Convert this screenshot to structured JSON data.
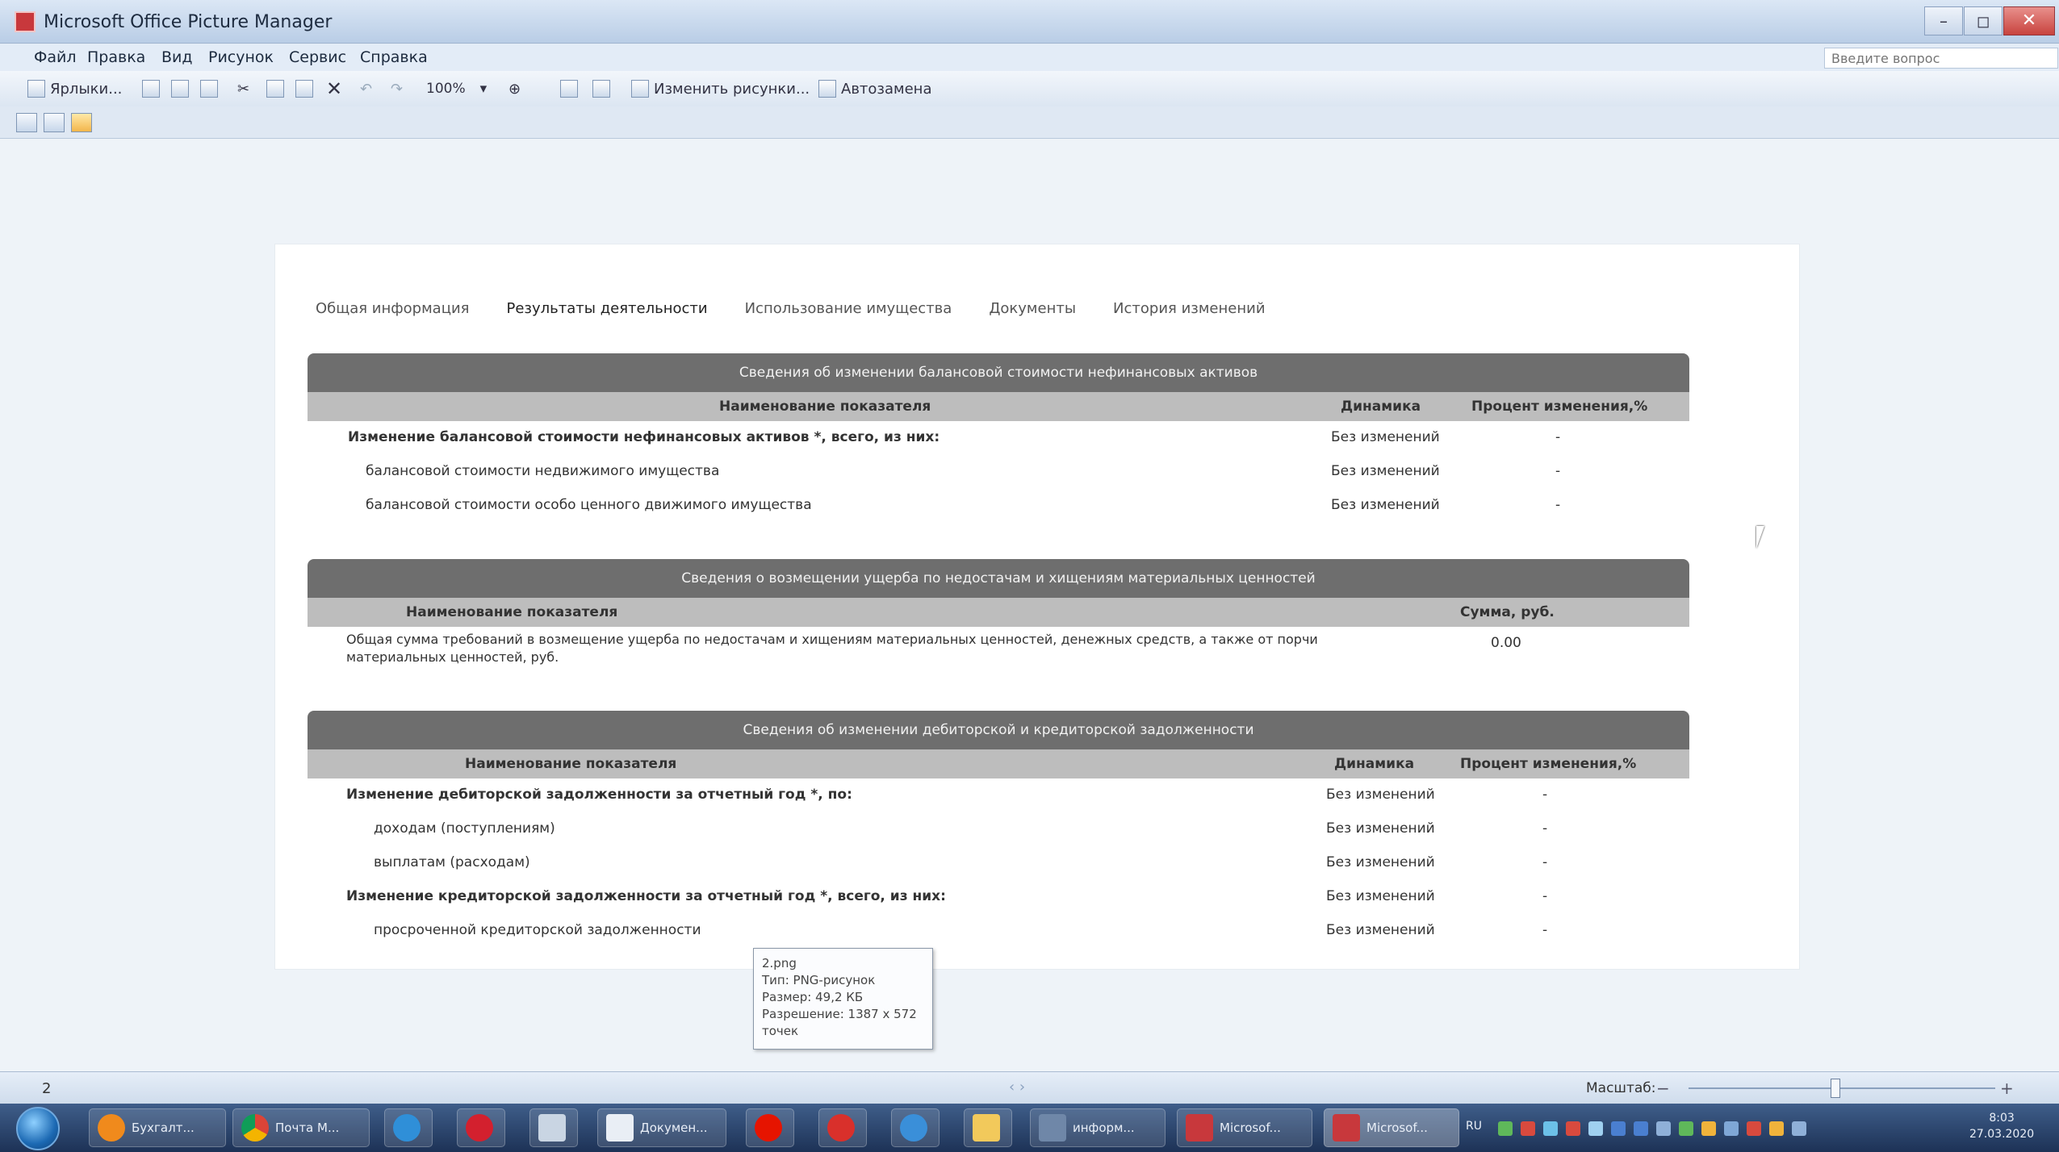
{
  "window": {
    "title": "Microsoft Office Picture Manager",
    "controls": {
      "minimize": "–",
      "maximize": "◻",
      "close": "✕"
    }
  },
  "menu": {
    "items": [
      "Файл",
      "Правка",
      "Вид",
      "Рисунок",
      "Сервис",
      "Справка"
    ],
    "help_placeholder": "Введите вопрос"
  },
  "toolbar": {
    "shortcuts_label": "Ярлыки...",
    "zoom_value": "100%",
    "edit_pictures_label": "Изменить рисунки...",
    "autocorrect_label": "Автозамена"
  },
  "page": {
    "tabs": [
      "Общая информация",
      "Результаты деятельности",
      "Использование имущества",
      "Документы",
      "История изменений"
    ],
    "active_tab": "Результаты деятельности",
    "sections": {
      "assets": {
        "title": "Сведения об изменении балансовой стоимости нефинансовых активов",
        "columns": [
          "Наименование показателя",
          "Динамика",
          "Процент изменения,%"
        ],
        "rows": [
          {
            "name": "Изменение балансовой стоимости нефинансовых активов *, всего, из них:",
            "dynamics": "Без изменений",
            "percent": "-"
          },
          {
            "name": "балансовой стоимости недвижимого имущества",
            "dynamics": "Без изменений",
            "percent": "-"
          },
          {
            "name": "балансовой стоимости особо ценного движимого имущества",
            "dynamics": "Без изменений",
            "percent": "-"
          }
        ]
      },
      "damage": {
        "title": "Сведения о возмещении ущерба по недостачам и хищениям материальных ценностей",
        "columns": [
          "Наименование показателя",
          "Сумма, руб."
        ],
        "rows": [
          {
            "name_line1": "Общая сумма требований в возмещение ущерба по недостачам и хищениям материальных ценностей, денежных средств, а также от порчи",
            "name_line2": "материальных ценностей, руб.",
            "amount": "0.00"
          }
        ]
      },
      "debts": {
        "title": "Сведения об изменении дебиторской и кредиторской задолженности",
        "columns": [
          "Наименование показателя",
          "Динамика",
          "Процент изменения,%"
        ],
        "rows": [
          {
            "name": "Изменение дебиторской задолженности за отчетный год *, по:",
            "dynamics": "Без изменений",
            "percent": "-"
          },
          {
            "name": "доходам (поступлениям)",
            "dynamics": "Без изменений",
            "percent": "-"
          },
          {
            "name": "выплатам (расходам)",
            "dynamics": "Без изменений",
            "percent": "-"
          },
          {
            "name": "Изменение кредиторской задолженности за отчетный год *, всего, из них:",
            "dynamics": "Без изменений",
            "percent": "-"
          },
          {
            "name": "просроченной кредиторской задолженности",
            "dynamics": "Без изменений",
            "percent": "-"
          }
        ]
      }
    }
  },
  "tooltip": {
    "filename": "2.png",
    "type": "Тип: PNG-рисунок",
    "size": "Размер: 49,2 КБ",
    "resolution": "Разрешение: 1387 x 572",
    "pixels": "точек"
  },
  "status": {
    "count": "2",
    "nav": "‹  ›",
    "zoom_label": "Масштаб:"
  },
  "taskbar": {
    "items": [
      "Бухгалт...",
      "Почта М...",
      "Докумен...",
      "информ...",
      "Microsof...",
      "Microsof..."
    ],
    "lang": "RU",
    "time": "8:03",
    "date": "27.03.2020"
  }
}
